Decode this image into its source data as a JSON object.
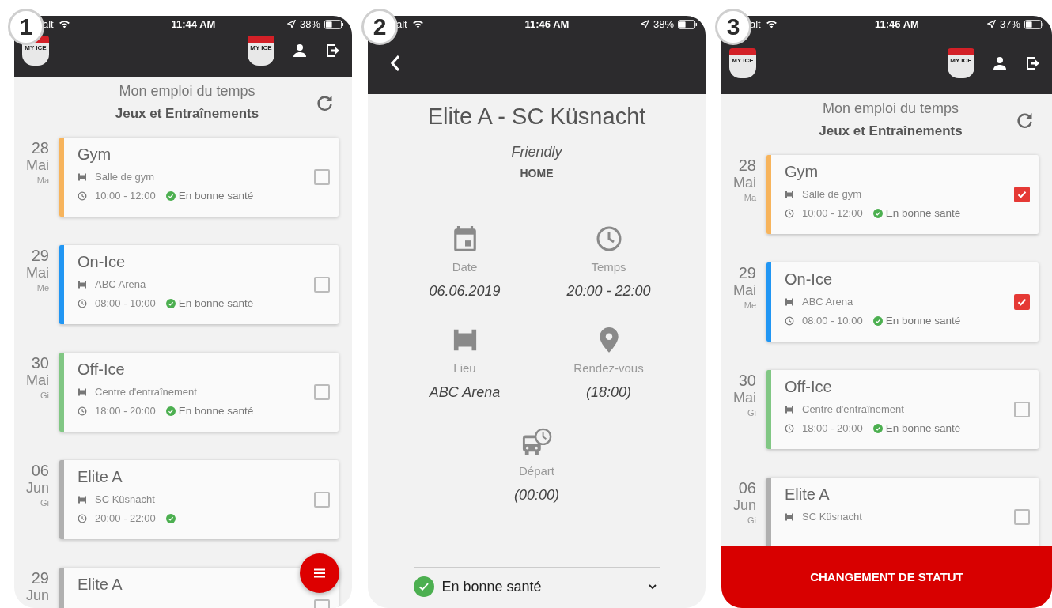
{
  "screens": [
    {
      "kind": "schedule",
      "step": "1",
      "status_bar": {
        "carrier": "alt",
        "time": "11:44 AM",
        "battery": "38%"
      },
      "header": {
        "collapsed": true,
        "logo_text": "MY ICE",
        "team_logo_text": "MY ICE"
      },
      "title": "Mon emploi du temps",
      "subtitle": "Jeux et Entraînements",
      "fab_menu": true,
      "events": [
        {
          "day": "28",
          "month": "Mai",
          "weekday": "Ma",
          "title": "Gym",
          "location": "Salle de gym",
          "time": "10:00 - 12:00",
          "healthy": true,
          "status": "En bonne santé",
          "color": "#f7b45c",
          "checked": false
        },
        {
          "day": "29",
          "month": "Mai",
          "weekday": "Me",
          "title": "On-Ice",
          "location": "ABC Arena",
          "time": "08:00 - 10:00",
          "healthy": true,
          "status": "En bonne santé",
          "color": "#2196f3",
          "checked": false
        },
        {
          "day": "30",
          "month": "Mai",
          "weekday": "Gi",
          "title": "Off-Ice",
          "location": "Centre d'entraînement",
          "time": "18:00 - 20:00",
          "healthy": true,
          "status": "En bonne santé",
          "color": "#81c784",
          "checked": false
        },
        {
          "day": "06",
          "month": "Jun",
          "weekday": "Gi",
          "title": "Elite A",
          "location": "SC Küsnacht",
          "time": "20:00 - 22:00",
          "healthy": true,
          "color": "#b0b0b0",
          "checked": false
        },
        {
          "day": "29",
          "month": "Jun",
          "title": "Elite A",
          "color": "#b0b0b0",
          "checked": false
        }
      ]
    },
    {
      "kind": "detail",
      "step": "2",
      "status_bar": {
        "carrier": "alt",
        "time": "11:46 AM",
        "battery": "38%"
      },
      "title": "Elite A - SC Küsnacht",
      "match_type": "Friendly",
      "side": "HOME",
      "info": [
        {
          "kind": "date",
          "label": "Date",
          "value": "06.06.2019"
        },
        {
          "kind": "time",
          "label": "Temps",
          "value": "20:00 - 22:00"
        },
        {
          "kind": "venue",
          "label": "Lieu",
          "value": "ABC Arena"
        },
        {
          "kind": "meeting",
          "label": "Rendez-vous",
          "value": "(18:00)"
        },
        {
          "kind": "departure",
          "label": "Départ",
          "value": "(00:00)"
        }
      ],
      "status": {
        "label": "En bonne santé"
      }
    },
    {
      "kind": "schedule",
      "step": "3",
      "status_bar": {
        "carrier": "alt",
        "time": "11:46 AM",
        "battery": "37%"
      },
      "header": {
        "collapsed": false,
        "logo_text": "MY ICE",
        "team_logo_text": "MY ICE"
      },
      "title": "Mon emploi du temps",
      "subtitle": "Jeux et Entraînements",
      "action_button": "CHANGEMENT DE STATUT",
      "events": [
        {
          "day": "28",
          "month": "Mai",
          "weekday": "Ma",
          "title": "Gym",
          "location": "Salle de gym",
          "time": "10:00 - 12:00",
          "healthy": true,
          "status": "En bonne santé",
          "color": "#f7b45c",
          "checked": true
        },
        {
          "day": "29",
          "month": "Mai",
          "weekday": "Me",
          "title": "On-Ice",
          "location": "ABC Arena",
          "time": "08:00 - 10:00",
          "healthy": true,
          "status": "En bonne santé",
          "color": "#2196f3",
          "checked": true
        },
        {
          "day": "30",
          "month": "Mai",
          "weekday": "Gi",
          "title": "Off-Ice",
          "location": "Centre d'entraînement",
          "time": "18:00 - 20:00",
          "healthy": true,
          "status": "En bonne santé",
          "color": "#81c784",
          "checked": false
        },
        {
          "day": "06",
          "month": "Jun",
          "weekday": "Gi",
          "title": "Elite A",
          "location": "SC Küsnacht",
          "color": "#b0b0b0",
          "checked": false
        }
      ]
    }
  ]
}
